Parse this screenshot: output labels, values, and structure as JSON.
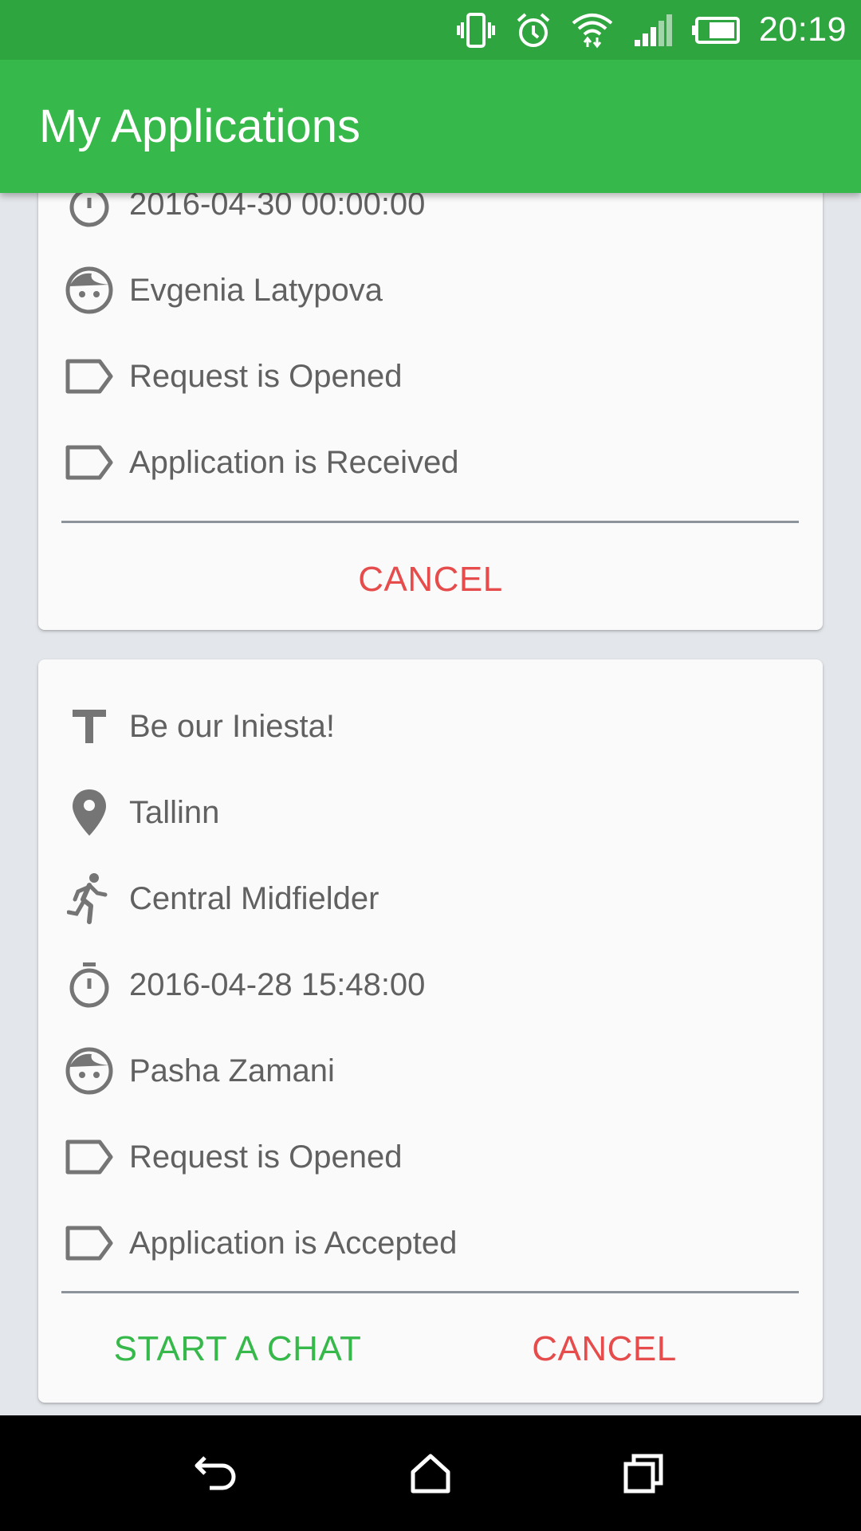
{
  "status_bar": {
    "time": "20:19",
    "icons": [
      "vibrate-icon",
      "alarm-icon",
      "wifi-icon",
      "signal-icon",
      "battery-icon"
    ]
  },
  "app_bar": {
    "title": "My Applications"
  },
  "cards": [
    {
      "rows": [
        {
          "icon": "timer-icon",
          "text": "2016-04-30 00:00:00"
        },
        {
          "icon": "face-icon",
          "text": "Evgenia Latypova"
        },
        {
          "icon": "label-icon",
          "text": "Request is Opened"
        },
        {
          "icon": "label-icon",
          "text": "Application is Received"
        }
      ],
      "actions": {
        "cancel": "CANCEL"
      }
    },
    {
      "rows": [
        {
          "icon": "title-icon",
          "text": "Be our Iniesta!"
        },
        {
          "icon": "location-pin-icon",
          "text": "Tallinn"
        },
        {
          "icon": "running-person-icon",
          "text": "Central Midfielder"
        },
        {
          "icon": "timer-icon",
          "text": "2016-04-28 15:48:00"
        },
        {
          "icon": "face-icon",
          "text": "Pasha Zamani"
        },
        {
          "icon": "label-icon",
          "text": "Request is Opened"
        },
        {
          "icon": "label-icon",
          "text": "Application is Accepted"
        }
      ],
      "actions": {
        "chat": "START A CHAT",
        "cancel": "CANCEL"
      }
    }
  ],
  "nav_bar": {
    "buttons": [
      "back-icon",
      "home-icon",
      "recents-icon"
    ]
  },
  "colors": {
    "status_bar": "#2ea53f",
    "app_bar": "#36b94a",
    "cancel": "#e74c4c",
    "chat": "#36b94a",
    "icon": "#757575",
    "text": "#616161",
    "background": "#e3e6ea"
  }
}
